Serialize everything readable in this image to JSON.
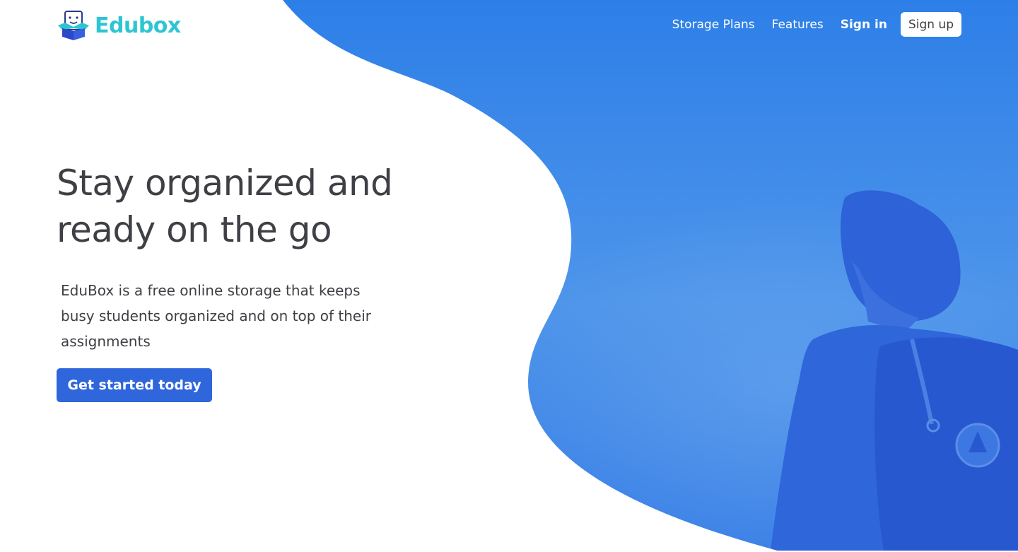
{
  "brand": {
    "name": "Edubox",
    "icon": "box-mascot-icon",
    "color": "#2ec5d3"
  },
  "nav": {
    "storage_plans": "Storage Plans",
    "features": "Features",
    "sign_in": "Sign in",
    "sign_up": "Sign up"
  },
  "hero": {
    "title_line1": "Stay organized and",
    "title_line2": "ready on the go",
    "description_line1": "EduBox is a free online storage that keeps",
    "description_line2": "busy students organized and on top of their",
    "description_line3": "assignments",
    "cta_label": "Get started today",
    "image": "student-with-backpack-photo"
  },
  "colors": {
    "accent": "#2f66dc",
    "hero_blue": "#3079e6",
    "text": "#3f4045"
  }
}
